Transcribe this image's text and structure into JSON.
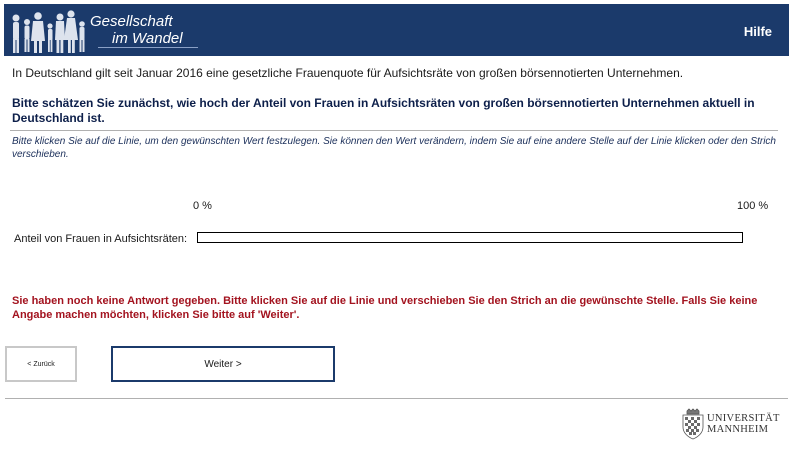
{
  "header": {
    "logo_line1": "Gesellschaft",
    "logo_line2": "im Wandel",
    "help_label": "Hilfe",
    "background_color": "#1b3a6b"
  },
  "intro_text": "In Deutschland gilt seit Januar 2016 eine gesetzliche Frauenquote für Aufsichtsräte von großen börsennotierten Unternehmen.",
  "question_text": "Bitte schätzen Sie zunächst, wie hoch der Anteil von Frauen in Aufsichtsräten von großen börsennotierten Unternehmen aktuell in Deutschland ist.",
  "instruction_text": "Bitte klicken Sie auf die Linie, um den gewünschten Wert festzulegen. Sie können den Wert verändern, indem Sie auf eine andere Stelle auf der Linie klicken oder den Strich verschieben.",
  "slider": {
    "min_label": "0 %",
    "max_label": "100 %",
    "label": "Anteil von Frauen in Aufsichtsräten:"
  },
  "error_text": "Sie haben noch keine Antwort gegeben. Bitte klicken Sie auf die Linie und verschieben Sie den Strich an die gewünschte Stelle. Falls Sie keine Angabe machen möchten, klicken Sie bitte auf 'Weiter'.",
  "buttons": {
    "back_label": "< Zurück",
    "next_label": "Weiter >"
  },
  "footer": {
    "uni_line1": "UNIVERSITÄT",
    "uni_line2": "MANNHEIM",
    "crest_icon": "university-crest-icon"
  },
  "colors": {
    "brand_navy": "#1b3a6b",
    "question_text": "#0d1f4a",
    "error_red": "#a3131f"
  }
}
